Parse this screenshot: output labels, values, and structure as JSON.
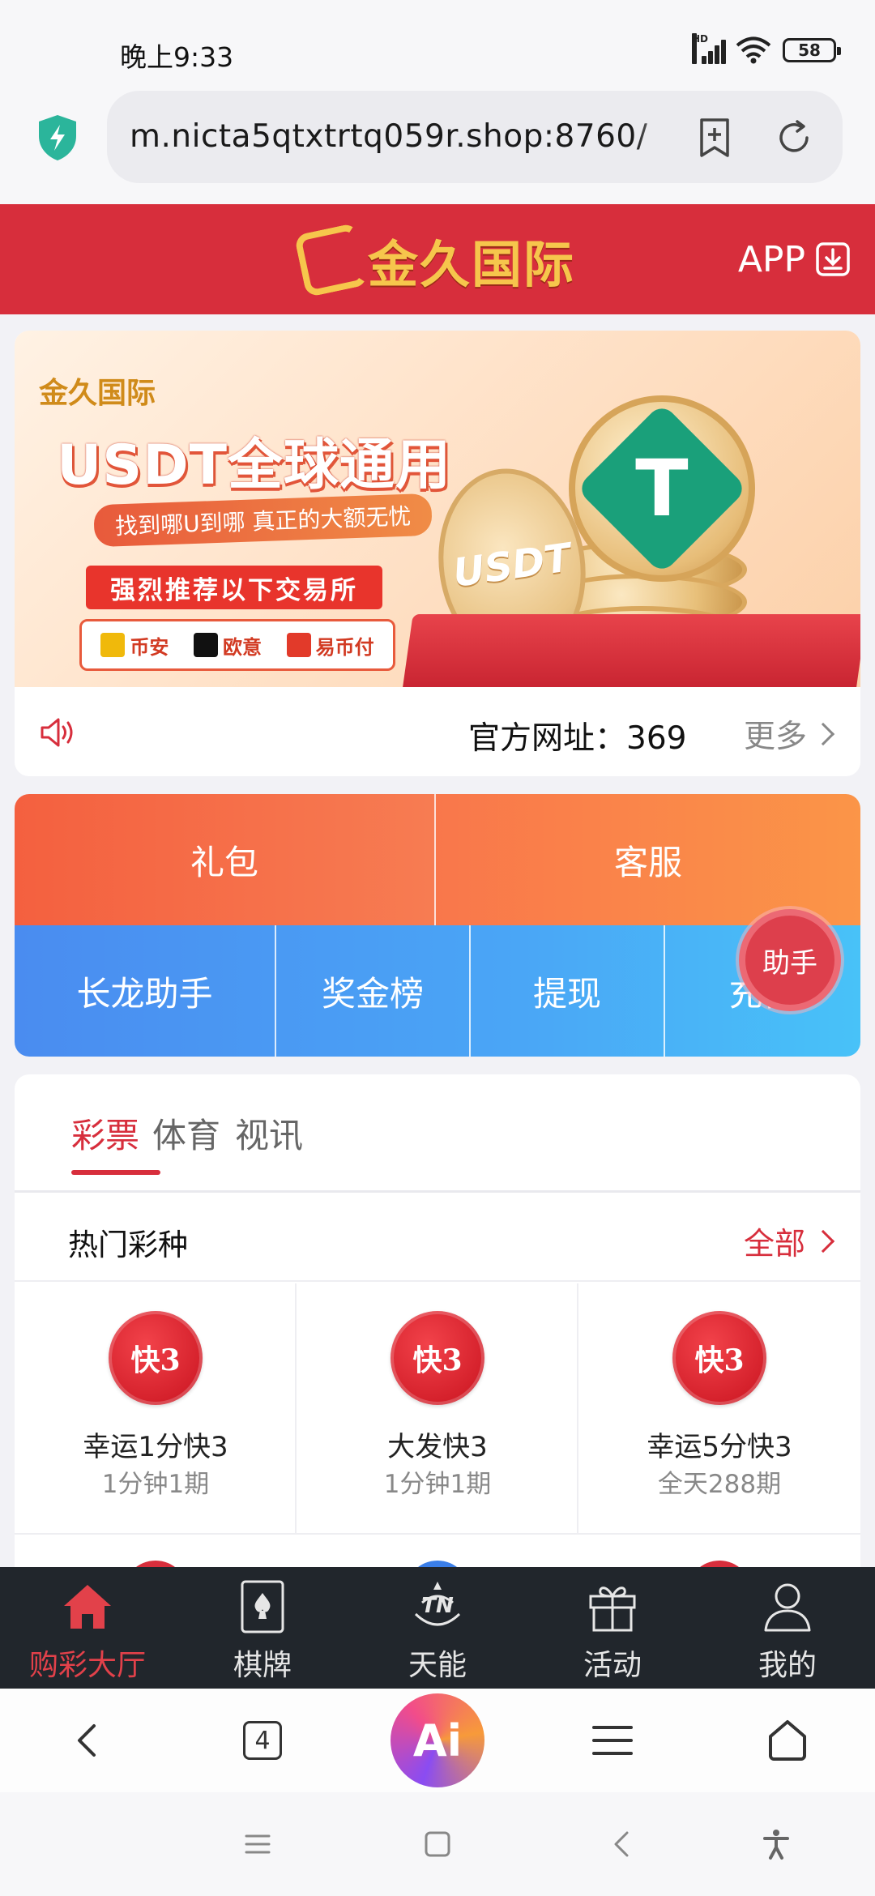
{
  "status_bar": {
    "time": "晚上9:33",
    "network": "HD",
    "battery": "58"
  },
  "browser": {
    "url": "m.nicta5qtxtrtq059r.shop:8760/",
    "tab_count": "4",
    "ai_label": "Ai"
  },
  "header": {
    "brand": "金久国际",
    "app_label": "APP"
  },
  "banner": {
    "brand": "金久国际",
    "title": "USDT全球通用",
    "subtitle": "找到哪U到哪 真正的大额无忧",
    "recommend": "强烈推荐以下交易所",
    "exchanges": [
      {
        "name": "币安",
        "color": "#f0b90b"
      },
      {
        "name": "欧意",
        "color": "#111111"
      },
      {
        "name": "易币付",
        "color": "#e23a2a"
      }
    ],
    "coin_label": "USDT",
    "tether_symbol": "T"
  },
  "notice": {
    "text": "官方网址：369",
    "more": "更多"
  },
  "quick": {
    "gift": "礼包",
    "service": "客服",
    "long_dragon": "长龙助手",
    "rewards": "奖金榜",
    "withdraw": "提现",
    "recharge": "充值",
    "assistant": "助手"
  },
  "tabs": [
    {
      "label": "彩票",
      "active": true
    },
    {
      "label": "体育",
      "active": false
    },
    {
      "label": "视讯",
      "active": false
    }
  ],
  "hot_section": {
    "title": "热门彩种",
    "all_label": "全部"
  },
  "games": [
    {
      "name": "幸运1分快3",
      "sub": "1分钟1期",
      "icon_text": "快3"
    },
    {
      "name": "大发快3",
      "sub": "1分钟1期",
      "icon_text": "快3"
    },
    {
      "name": "幸运5分快3",
      "sub": "全天288期",
      "icon_text": "快3"
    }
  ],
  "bottom_nav": [
    {
      "label": "购彩大厅",
      "icon": "home-icon",
      "active": true
    },
    {
      "label": "棋牌",
      "icon": "cards-icon",
      "active": false
    },
    {
      "label": "天能",
      "icon": "tn-icon",
      "active": false
    },
    {
      "label": "活动",
      "icon": "gift-icon",
      "active": false
    },
    {
      "label": "我的",
      "icon": "user-icon",
      "active": false
    }
  ],
  "colors": {
    "brand_red": "#d72e3c",
    "gold": "#f6c64c",
    "nav_bg": "#21262c",
    "orange_start": "#f4603f",
    "blue_start": "#4a8cf0"
  }
}
